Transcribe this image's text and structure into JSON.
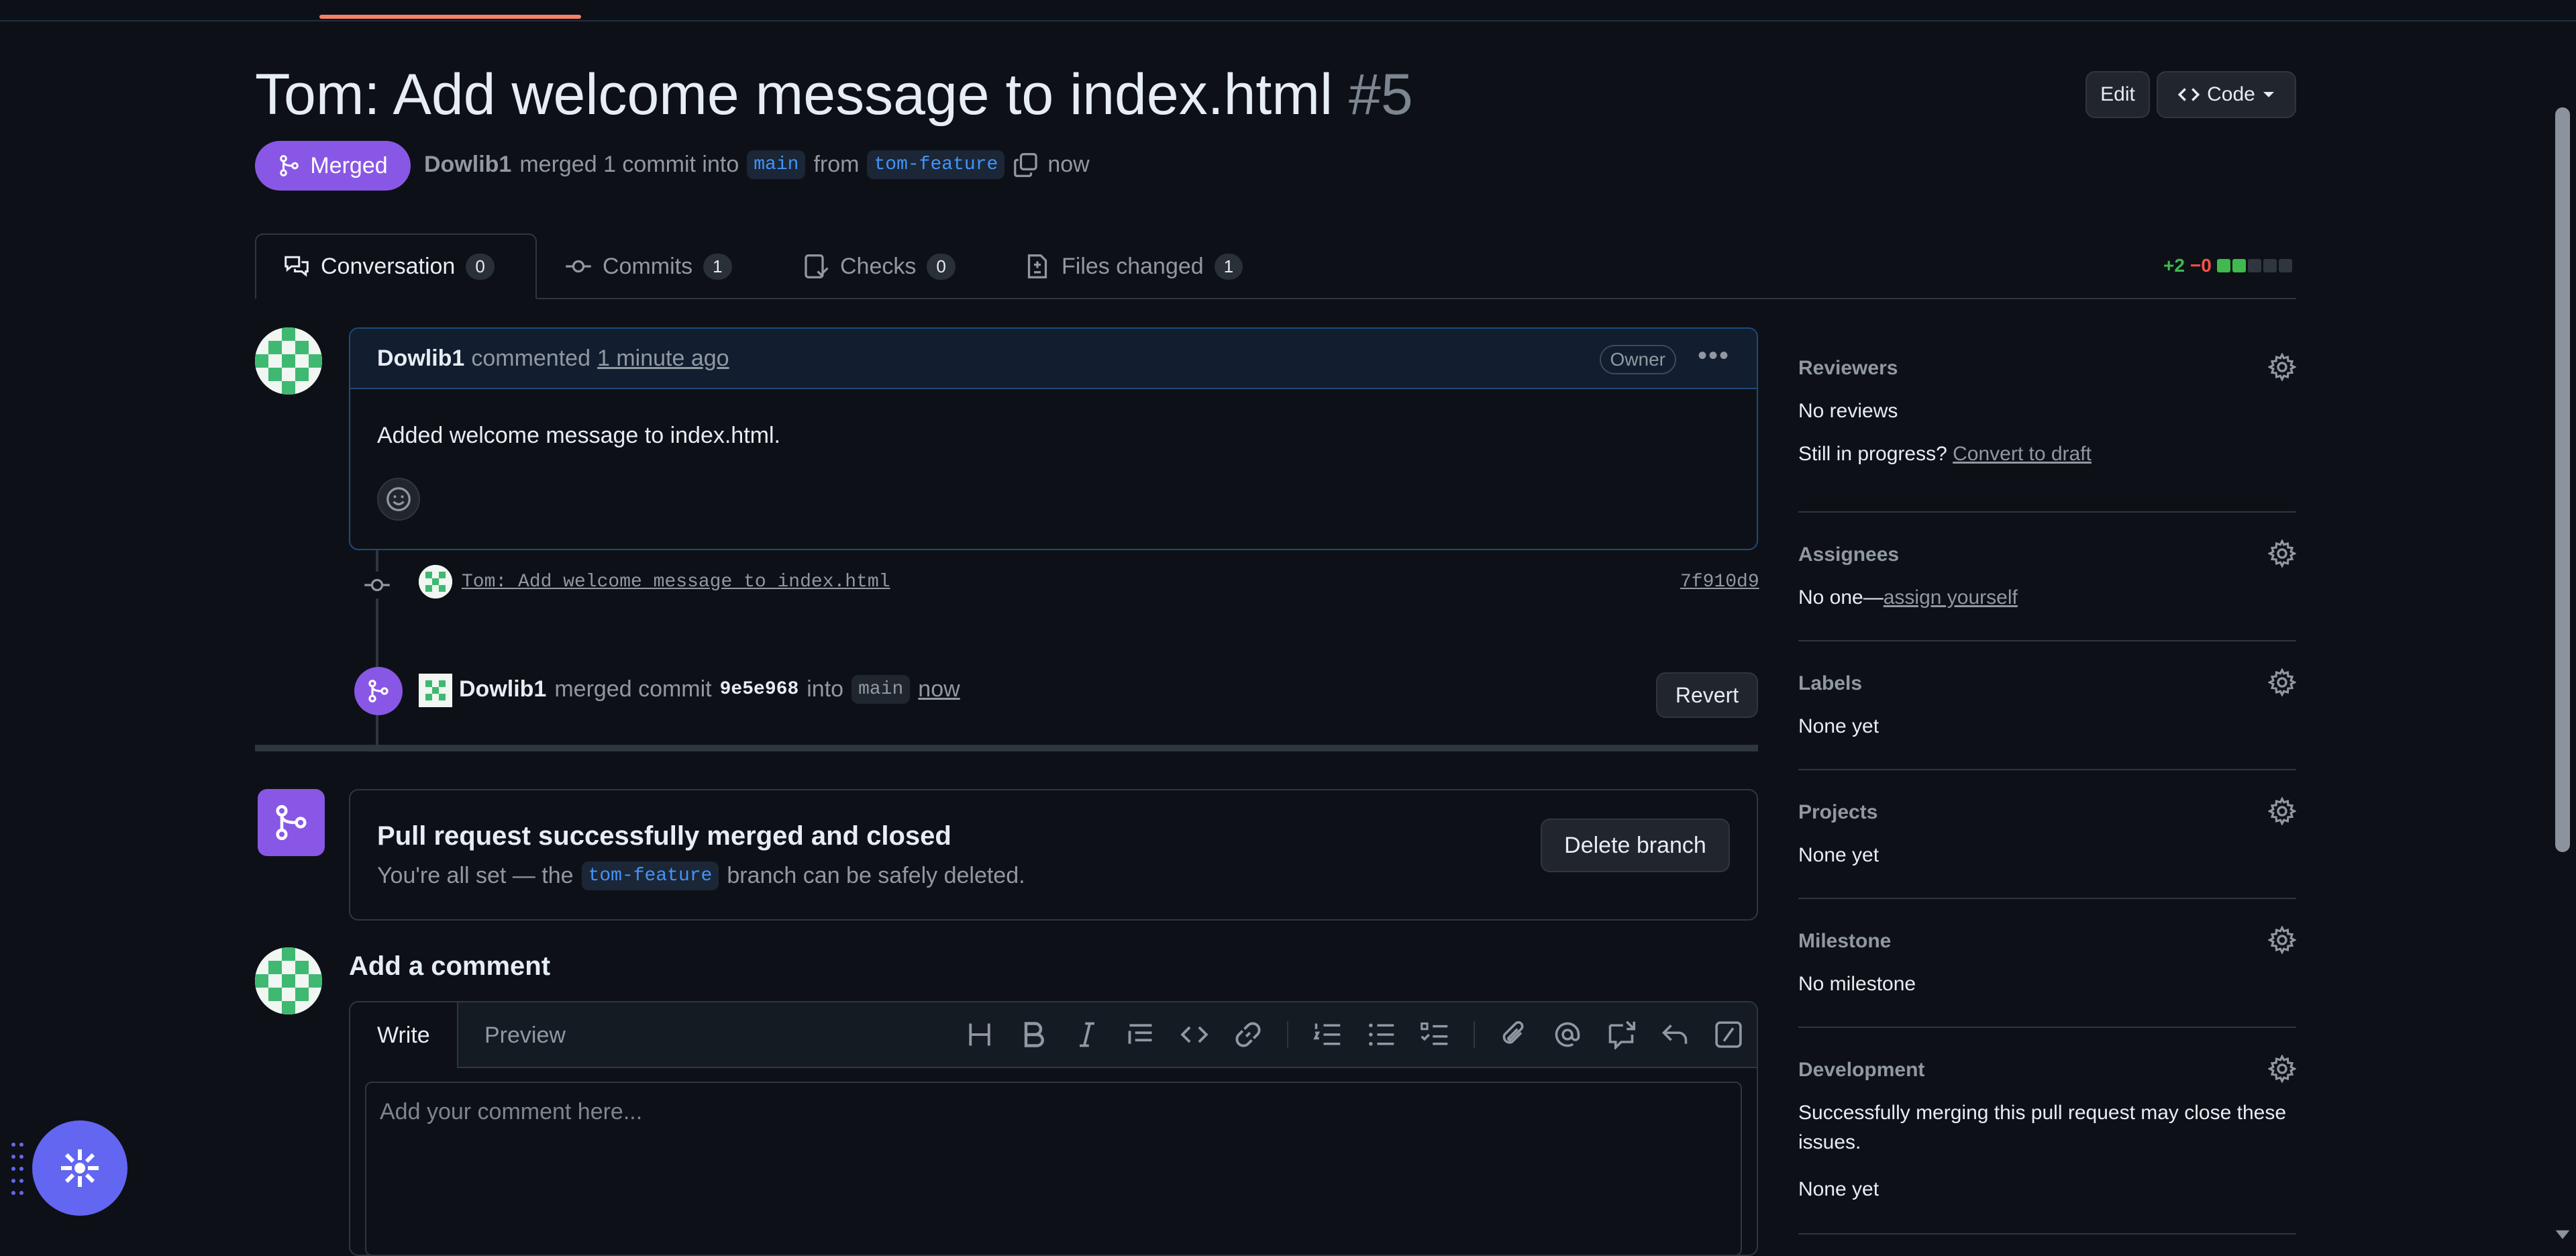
{
  "pr": {
    "title": "Tom: Add welcome message to index.html",
    "number": "#5",
    "state": "Merged",
    "author": "Dowlib1",
    "merge_text": "merged 1 commit into",
    "base_branch": "main",
    "from_text": "from",
    "head_branch": "tom-feature",
    "time": "now"
  },
  "header_buttons": {
    "edit": "Edit",
    "code": "Code"
  },
  "tabs": [
    {
      "label": "Conversation",
      "count": "0"
    },
    {
      "label": "Commits",
      "count": "1"
    },
    {
      "label": "Checks",
      "count": "0"
    },
    {
      "label": "Files changed",
      "count": "1"
    }
  ],
  "diffstat": {
    "additions": "+2",
    "deletions": "−0"
  },
  "comment": {
    "author": "Dowlib1",
    "action": "commented",
    "time": "1 minute ago",
    "badge": "Owner",
    "body": "Added welcome message to index.html."
  },
  "commit_event": {
    "message": "Tom: Add welcome message to index.html",
    "sha": "7f910d9"
  },
  "merge_event": {
    "author": "Dowlib1",
    "action": "merged commit",
    "sha": "9e5e968",
    "into": "into",
    "branch": "main",
    "time": "now",
    "revert_label": "Revert"
  },
  "merged_box": {
    "title": "Pull request successfully merged and closed",
    "sub_before": "You're all set — the",
    "branch": "tom-feature",
    "sub_after": "branch can be safely deleted.",
    "delete_label": "Delete branch"
  },
  "add_comment": {
    "title": "Add a comment",
    "write_tab": "Write",
    "preview_tab": "Preview",
    "placeholder": "Add your comment here..."
  },
  "sidebar": {
    "reviewers": {
      "title": "Reviewers",
      "value": "No reviews",
      "draft_prompt": "Still in progress?",
      "draft_link": "Convert to draft"
    },
    "assignees": {
      "title": "Assignees",
      "value": "No one—",
      "link": "assign yourself"
    },
    "labels": {
      "title": "Labels",
      "value": "None yet"
    },
    "projects": {
      "title": "Projects",
      "value": "None yet"
    },
    "milestone": {
      "title": "Milestone",
      "value": "No milestone"
    },
    "development": {
      "title": "Development",
      "line1": "Successfully merging this pull request may close these",
      "line2": "issues.",
      "value": "None yet"
    }
  },
  "colors": {
    "merged": "#8957e5",
    "accent_link": "#4493f8",
    "addition": "#3fb950",
    "deletion": "#f85149",
    "fab": "#6366f1"
  },
  "icons": [
    "git-merge-icon",
    "copy-icon",
    "code-icon",
    "conversation-icon",
    "commit-icon",
    "checks-icon",
    "file-diff-icon",
    "kebab-icon",
    "smiley-icon",
    "gear-icon",
    "heading-icon",
    "bold-icon",
    "italic-icon",
    "quote-icon",
    "link-icon",
    "ordered-list-icon",
    "unordered-list-icon",
    "task-list-icon",
    "attach-icon",
    "mention-icon",
    "reference-icon",
    "reply-icon",
    "slash-icon",
    "assistant-icon"
  ]
}
